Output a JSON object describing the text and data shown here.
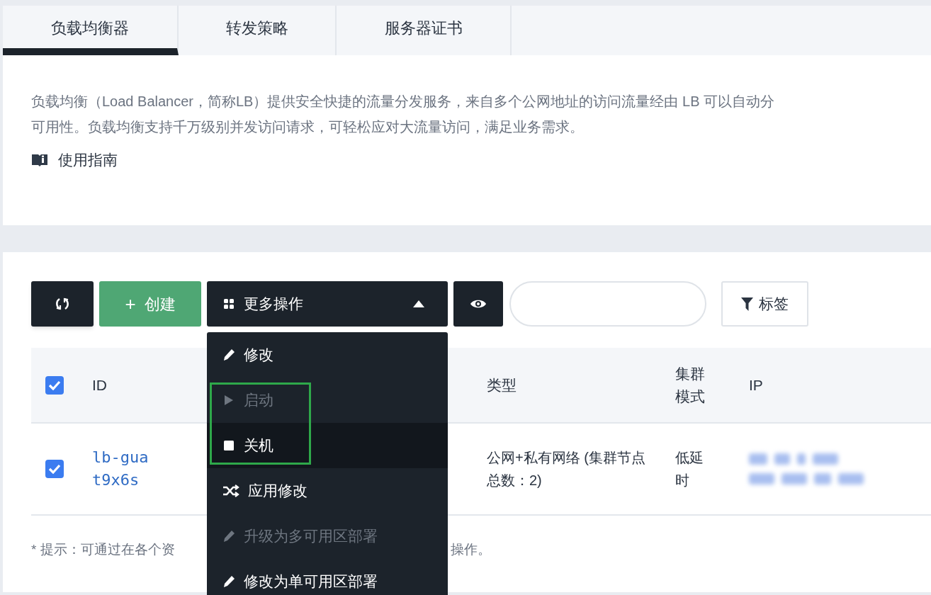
{
  "tabs": [
    {
      "label": "负载均衡器",
      "selected": true
    },
    {
      "label": "转发策略",
      "selected": false
    },
    {
      "label": "服务器证书",
      "selected": false
    }
  ],
  "intro": {
    "lines": [
      "负载均衡（Load Balancer，简称LB）提供安全快捷的流量分发服务，来自多个公网地址的访问流量经由 LB 可以自动分",
      "可用性。负载均衡支持千万级别并发访问请求，可轻松应对大流量访问，满足业务需求。"
    ],
    "guide_link": "使用指南"
  },
  "toolbar": {
    "create": "创建",
    "create_sign": "+",
    "more_actions": "更多操作",
    "tag_filter": "标签"
  },
  "table": {
    "select_all_checked": true,
    "columns": [
      "ID",
      "类型",
      "集群模式",
      "IP"
    ],
    "rows": [
      {
        "checked": true,
        "id": "lb-guat9x6s",
        "type": "公网+私有网络 (集群节点总数：2)",
        "cluster_mode": "低延时"
      }
    ]
  },
  "hint": {
    "before": "* 提示：可通过在各个资",
    "after": "操作。"
  },
  "menu": {
    "expanded": true,
    "items": [
      {
        "kind": "edit",
        "label": "修改",
        "disabled": false,
        "hovered": false
      },
      {
        "kind": "start",
        "label": "启动",
        "disabled": true,
        "hovered": false
      },
      {
        "kind": "stop",
        "label": "关机",
        "disabled": false,
        "hovered": true
      },
      {
        "kind": "apply",
        "label": "应用修改",
        "disabled": false,
        "hovered": false
      },
      {
        "kind": "edit",
        "label": "升级为多可用区部署",
        "disabled": true,
        "hovered": false
      },
      {
        "kind": "edit",
        "label": "修改为单可用区部署",
        "disabled": false,
        "hovered": false
      }
    ]
  }
}
